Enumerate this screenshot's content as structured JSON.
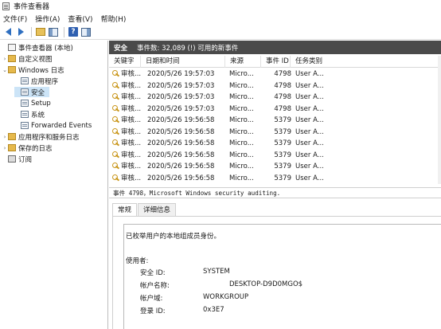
{
  "window": {
    "title": "事件查看器"
  },
  "menu": [
    "文件(F)",
    "操作(A)",
    "查看(V)",
    "帮助(H)"
  ],
  "toolbar": {
    "icons": [
      "back-arrow-icon",
      "forward-arrow-icon",
      "folder-up-icon",
      "console-tree-icon",
      "help-icon",
      "action-pane-icon"
    ]
  },
  "tree": [
    {
      "label": "事件查看器 (本地)",
      "chevron": "",
      "icon": "viewer"
    },
    {
      "label": "自定义视图",
      "chevron": "›",
      "icon": "folder"
    },
    {
      "label": "Windows 日志",
      "chevron": "⌄",
      "icon": "folder"
    },
    {
      "label": "应用程序",
      "chevron": "",
      "icon": "log"
    },
    {
      "label": "安全",
      "chevron": "",
      "icon": "log",
      "selected": true
    },
    {
      "label": "Setup",
      "chevron": "",
      "icon": "log"
    },
    {
      "label": "系统",
      "chevron": "",
      "icon": "log"
    },
    {
      "label": "Forwarded Events",
      "chevron": "",
      "icon": "log"
    },
    {
      "label": "应用程序和服务日志",
      "chevron": "›",
      "icon": "folder"
    },
    {
      "label": "保存的日志",
      "chevron": "›",
      "icon": "folder"
    },
    {
      "label": "订阅",
      "chevron": "",
      "icon": "sub"
    }
  ],
  "header": {
    "title": "安全",
    "summary": "事件数: 32,089 (!) 可用的新事件"
  },
  "table": {
    "columns": [
      "关键字",
      "日期和时间",
      "来源",
      "事件 ID",
      "任务类别"
    ],
    "rows": [
      [
        "审核...",
        "2020/5/26 19:57:03",
        "Micro...",
        "4798",
        "User A..."
      ],
      [
        "审核...",
        "2020/5/26 19:57:03",
        "Micro...",
        "4798",
        "User A..."
      ],
      [
        "审核...",
        "2020/5/26 19:57:03",
        "Micro...",
        "4798",
        "User A..."
      ],
      [
        "审核...",
        "2020/5/26 19:57:03",
        "Micro...",
        "4798",
        "User A..."
      ],
      [
        "审核...",
        "2020/5/26 19:56:58",
        "Micro...",
        "5379",
        "User A..."
      ],
      [
        "审核...",
        "2020/5/26 19:56:58",
        "Micro...",
        "5379",
        "User A..."
      ],
      [
        "审核...",
        "2020/5/26 19:56:58",
        "Micro...",
        "5379",
        "User A..."
      ],
      [
        "审核...",
        "2020/5/26 19:56:58",
        "Micro...",
        "5379",
        "User A..."
      ],
      [
        "审核...",
        "2020/5/26 19:56:58",
        "Micro...",
        "5379",
        "User A..."
      ],
      [
        "审核...",
        "2020/5/26 19:56:58",
        "Micro...",
        "5379",
        "User A..."
      ]
    ]
  },
  "detail": {
    "title": "事件 4798，Microsoft Windows security auditing.",
    "tabs": [
      "常规",
      "详细信息"
    ],
    "description": "已枚举用户的本地组成员身份。",
    "section_label": "使用者:",
    "fields": [
      {
        "label": "安全 ID:",
        "value": "SYSTEM"
      },
      {
        "label": "帐户名称:",
        "value": "DESKTOP-D9D0MGO$"
      },
      {
        "label": "帐户域:",
        "value": "WORKGROUP"
      },
      {
        "label": "登录 ID:",
        "value": "0x3E7"
      }
    ]
  }
}
